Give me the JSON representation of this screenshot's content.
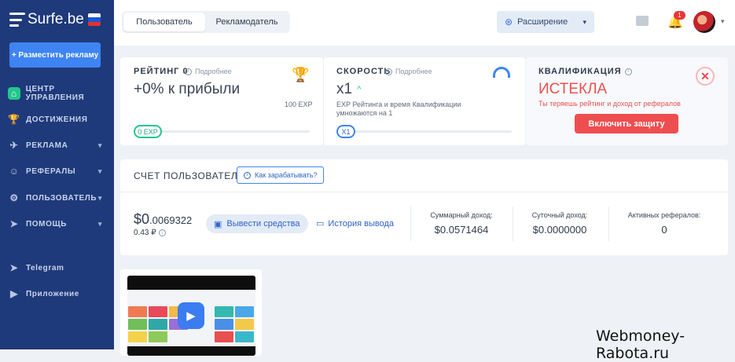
{
  "brand": {
    "name": "Surfe.be",
    "flag": [
      "#ffffff",
      "#1c56d6",
      "#e2322e"
    ]
  },
  "sidebar": {
    "place_ad": "+ Разместить рекламу",
    "items": [
      {
        "label": "ЦЕНТР УПРАВЛЕНИЯ",
        "icon": "home-icon",
        "active": true,
        "chevron": false
      },
      {
        "label": "ДОСТИЖЕНИЯ",
        "icon": "trophy-icon",
        "active": false,
        "chevron": false
      },
      {
        "label": "РЕКЛАМА",
        "icon": "megaphone-icon",
        "active": false,
        "chevron": true
      },
      {
        "label": "РЕФЕРАЛЫ",
        "icon": "referrals-icon",
        "active": false,
        "chevron": true
      },
      {
        "label": "ПОЛЬЗОВАТЕЛЬ",
        "icon": "user-icon",
        "active": false,
        "chevron": true
      },
      {
        "label": "ПОМОЩЬ",
        "icon": "help-icon",
        "active": false,
        "chevron": true
      }
    ],
    "links": [
      {
        "label": "Telegram",
        "icon": "telegram-icon"
      },
      {
        "label": "Приложение",
        "icon": "app-icon"
      }
    ]
  },
  "topbar": {
    "tabs": [
      "Пользователь",
      "Рекламодатель"
    ],
    "extension": "Расширение",
    "notifications": "1"
  },
  "rating": {
    "title": "РЕЙТИНГ 0",
    "more": "Подробнее",
    "value": "+0% к прибыли",
    "exp": "100 EXP",
    "current": "0 EXP",
    "progress": 0
  },
  "speed": {
    "title": "СКОРОСТЬ",
    "more": "Подробнее",
    "value": "x1",
    "desc_line1": "EXP Рейтинга и время Квалификации",
    "desc_line2": "умножаются на 1",
    "current": "X1",
    "progress": 0
  },
  "qualification": {
    "title": "КВАЛИФИКАЦИЯ",
    "status": "ИСТЕКЛА",
    "warning": "Ты теряешь рейтинг и доход от рефералов",
    "button": "Включить защиту"
  },
  "account": {
    "title": "СЧЕТ ПОЛЬЗОВАТЕЛЯ",
    "how_to_earn": "Как зарабатывать?",
    "balance_main": "$0",
    "balance_frac": ".0069322",
    "balance_rub": "0.43 ₽",
    "withdraw": "Вывести средства",
    "history": "История вывода",
    "stats": [
      {
        "label": "Суммарный доход:",
        "value": "$0.0571464"
      },
      {
        "label": "Суточный доход:",
        "value": "$0.0000000"
      },
      {
        "label": "Активных рефералов:",
        "value": "0"
      }
    ]
  },
  "watermark": "Webmoney-Rabota.ru"
}
